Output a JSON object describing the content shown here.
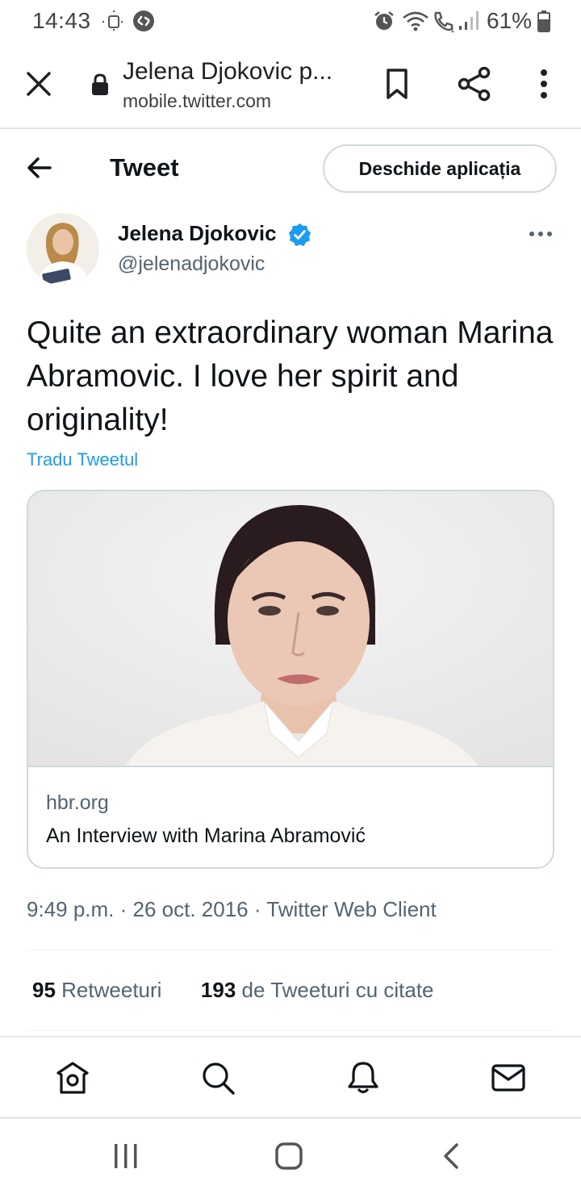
{
  "status_bar": {
    "time": "14:43",
    "battery": "61%",
    "icons": [
      "sun-icon",
      "shazam-icon",
      "alarm-icon",
      "wifi-icon",
      "call-icon",
      "signal-icon",
      "battery-icon"
    ]
  },
  "browser": {
    "page_title": "Jelena Djokovic p...",
    "url": "mobile.twitter.com"
  },
  "header": {
    "title": "Tweet",
    "open_app_label": "Deschide aplicația"
  },
  "tweet": {
    "author_name": "Jelena Djokovic",
    "author_handle": "@jelenadjokovic",
    "text": "Quite an extraordinary woman Marina Abramovic. I love her spirit and originality!",
    "translate_label": "Tradu Tweetul",
    "card": {
      "domain": "hbr.org",
      "title": "An Interview with Marina Abramović"
    },
    "meta": "9:49 p.m. · 26 oct. 2016 · Twitter Web Client",
    "retweets_count": "95",
    "retweets_label": "Retweeturi",
    "quotes_count": "193",
    "quotes_label": "de Tweeturi cu citate"
  },
  "colors": {
    "accent": "#1d9bf0",
    "text": "#0f1419",
    "secondary": "#536471",
    "border": "#cfd9de"
  }
}
